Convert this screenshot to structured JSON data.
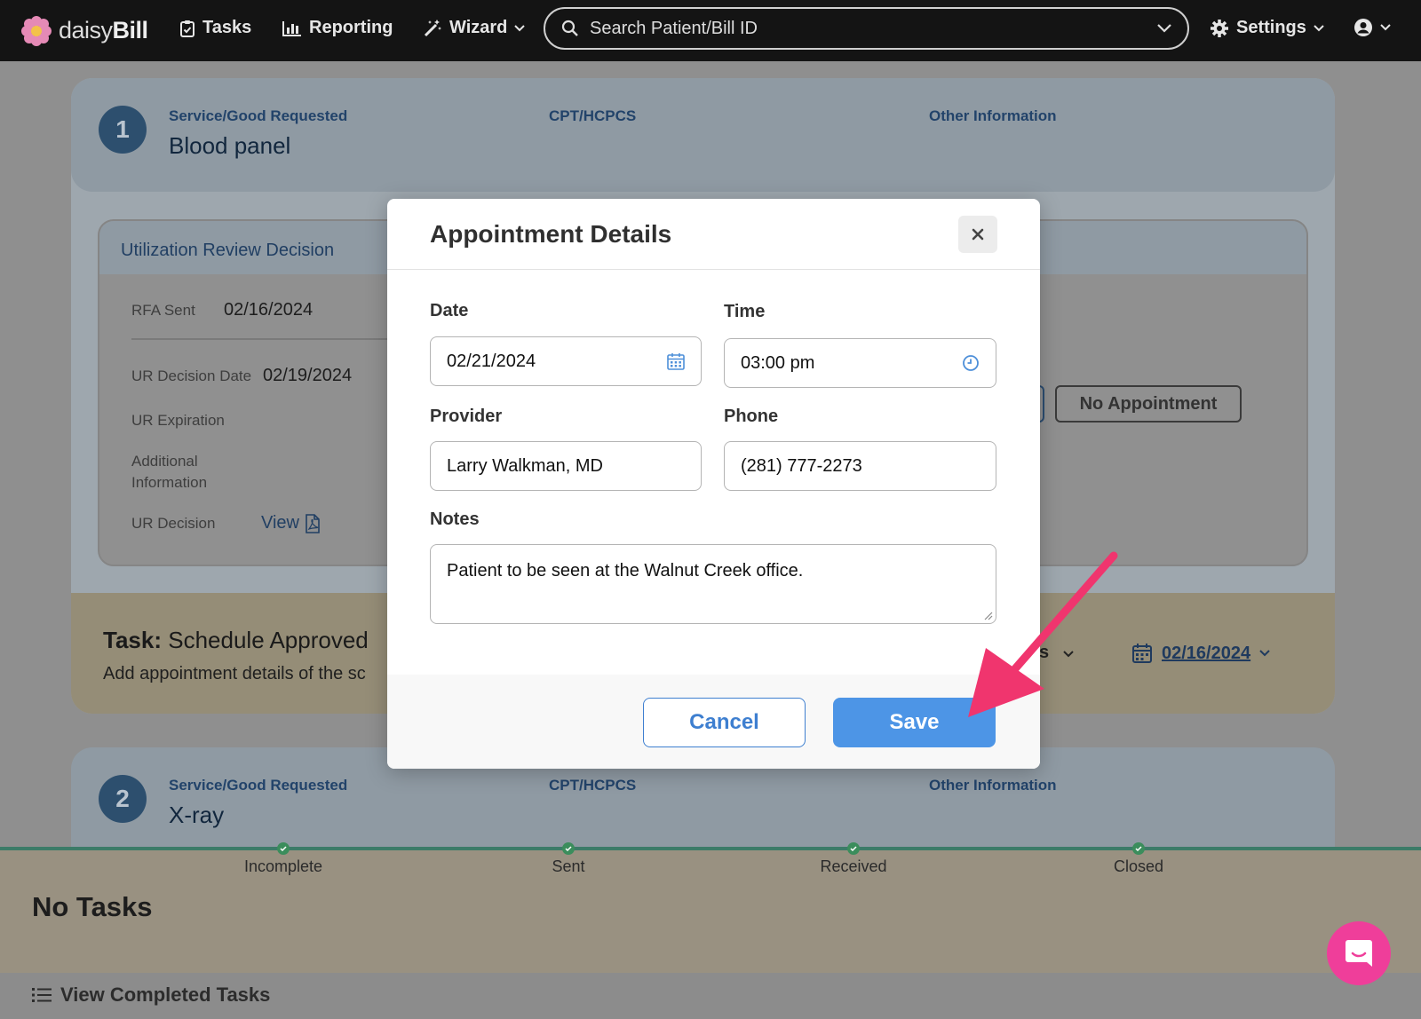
{
  "navbar": {
    "logo_light": "daisy",
    "logo_bold": "Bill",
    "tasks": "Tasks",
    "reporting": "Reporting",
    "wizard": "Wizard",
    "search_placeholder": "Search Patient/Bill ID",
    "settings": "Settings"
  },
  "service1": {
    "step": "1",
    "label_service": "Service/Good Requested",
    "value_service": "Blood panel",
    "label_cpt": "CPT/HCPCS",
    "label_other": "Other Information"
  },
  "ur": {
    "title": "Utilization Review Decision",
    "rfa_sent_label": "RFA Sent",
    "rfa_sent_value": "02/16/2024",
    "decision_date_label": "UR Decision Date",
    "decision_date_value": "02/19/2024",
    "expiration_label": "UR Expiration",
    "additional_label_1": "Additional",
    "additional_label_2": "Information",
    "decision_label": "UR Decision",
    "view_link": "View"
  },
  "appointment_buttons": {
    "no_appointment": "No Appointment"
  },
  "task": {
    "prefix": "Task:",
    "title": "Schedule Approved",
    "subtitle": "Add appointment details of the sc",
    "status_fragment": "s",
    "due_date": "02/16/2024"
  },
  "service2": {
    "step": "2",
    "label_service": "Service/Good Requested",
    "value_service": "X-ray",
    "label_cpt": "CPT/HCPCS",
    "label_other": "Other Information"
  },
  "progress": {
    "steps": [
      "Incomplete",
      "Sent",
      "Received",
      "Closed"
    ]
  },
  "tasks_panel": {
    "no_tasks": "No Tasks",
    "view_completed": "View Completed Tasks"
  },
  "modal": {
    "title": "Appointment Details",
    "date_label": "Date",
    "date_value": "02/21/2024",
    "time_label": "Time",
    "time_value": "03:00 pm",
    "provider_label": "Provider",
    "provider_value": "Larry Walkman, MD",
    "phone_label": "Phone",
    "phone_value": "(281) 777-2273",
    "notes_label": "Notes",
    "notes_value": "Patient to be seen at the Walnut Creek office.",
    "cancel": "Cancel",
    "save": "Save"
  },
  "colors": {
    "primary": "#4d95e6",
    "annotation_arrow": "#f0356e",
    "chat": "#ef3e9a"
  }
}
